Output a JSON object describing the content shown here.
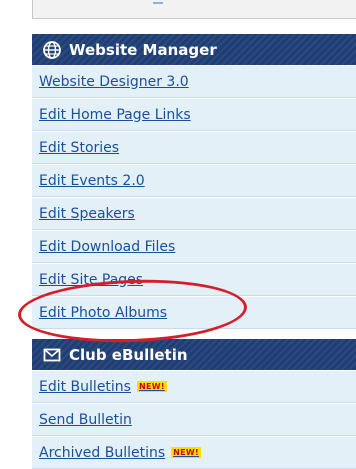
{
  "website_manager": {
    "title": "Website Manager",
    "icon": "globe-icon",
    "items": [
      {
        "label": "Website Designer 3.0"
      },
      {
        "label": "Edit Home Page Links"
      },
      {
        "label": "Edit Stories"
      },
      {
        "label": "Edit Events 2.0"
      },
      {
        "label": "Edit Speakers"
      },
      {
        "label": "Edit Download Files"
      },
      {
        "label": "Edit Site Pages"
      },
      {
        "label": "Edit Photo Albums"
      }
    ]
  },
  "club_ebulletin": {
    "title": "Club eBulletin",
    "icon": "envelope-icon",
    "items": [
      {
        "label": "Edit Bulletins",
        "badge": "NEW!"
      },
      {
        "label": "Send Bulletin"
      },
      {
        "label": "Archived Bulletins",
        "badge": "NEW!"
      }
    ]
  },
  "colors": {
    "header_bg": "#1f3f74",
    "item_bg": "#e4f0f8",
    "link": "#1a4f9a",
    "highlight_ring": "#d41e2a",
    "badge_bg": "#ffde00",
    "badge_text": "#c8000a"
  }
}
